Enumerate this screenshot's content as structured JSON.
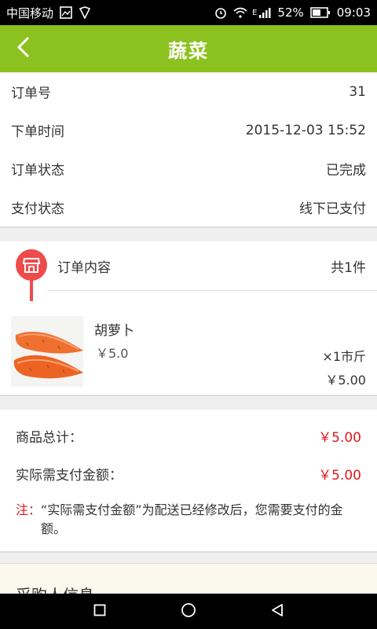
{
  "status_bar": {
    "carrier": "中国移动",
    "battery": "52%",
    "time": "09:03",
    "network": "E"
  },
  "header": {
    "title": "蔬菜",
    "back_icon": "chevron-left-icon"
  },
  "order_info": {
    "rows": [
      {
        "label": "订单号",
        "value": "31"
      },
      {
        "label": "下单时间",
        "value": "2015-12-03 15:52"
      },
      {
        "label": "订单状态",
        "value": "已完成"
      },
      {
        "label": "支付状态",
        "value": "线下已支付"
      }
    ]
  },
  "order_content": {
    "label": "订单内容",
    "count": "共1件",
    "icon": "shop-icon"
  },
  "product": {
    "name": "胡萝卜",
    "price": "￥5.0",
    "quantity": "×1市斤",
    "subtotal": "￥5.00",
    "image": "carrot-image"
  },
  "summary": {
    "goods_total_label": "商品总计：",
    "goods_total_value": "￥5.00",
    "actual_pay_label": "实际需支付金额：",
    "actual_pay_value": "￥5.00",
    "note_tag": "注：",
    "note_text": "“实际需支付金额”为配送已经修改后，您需要支付的金额。"
  },
  "buyer": {
    "heading": "采购人信息"
  },
  "colors": {
    "brand_green": "#8cc21f",
    "accent_red": "#e0191e",
    "badge_red": "#ef4b4b"
  }
}
